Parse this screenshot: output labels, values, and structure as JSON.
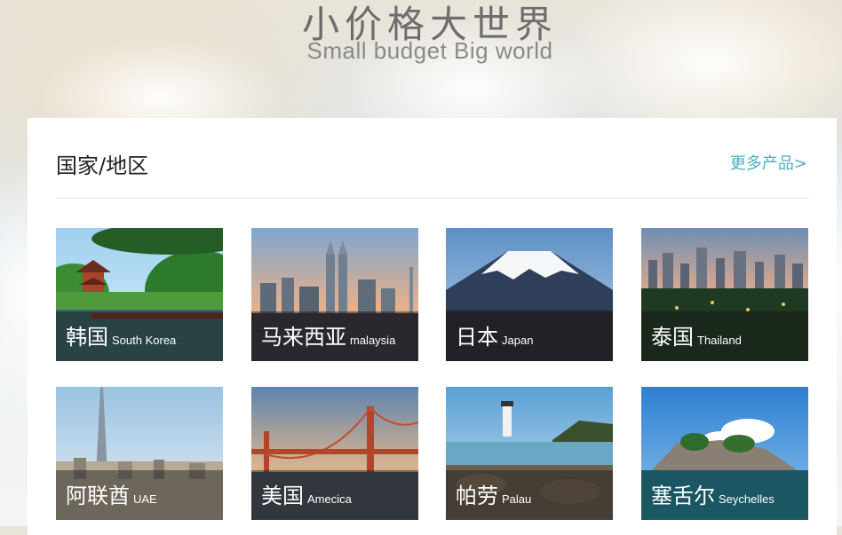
{
  "hero": {
    "title_cn": "小价格大世界",
    "title_en": "Small budget  Big world"
  },
  "section": {
    "title": "国家/地区",
    "more_link": "更多产品>"
  },
  "destinations": [
    {
      "name_cn": "韩国",
      "name_en": "South Korea",
      "scene": "pavilion"
    },
    {
      "name_cn": "马来西亚",
      "name_en": "malaysia",
      "scene": "twin-towers"
    },
    {
      "name_cn": "日本",
      "name_en": "Japan",
      "scene": "mount-fuji"
    },
    {
      "name_cn": "泰国",
      "name_en": "Thailand",
      "scene": "city-skyline"
    },
    {
      "name_cn": "阿联酋",
      "name_en": "UAE",
      "scene": "burj-tower"
    },
    {
      "name_cn": "美国",
      "name_en": "Amecica",
      "scene": "golden-gate"
    },
    {
      "name_cn": "帕劳",
      "name_en": "Palau",
      "scene": "lighthouse-coast"
    },
    {
      "name_cn": "塞舌尔",
      "name_en": "Seychelles",
      "scene": "tropical-island"
    }
  ],
  "colors": {
    "accent_link": "#4aaebf",
    "caption_overlay": "rgba(20,20,20,0.45)"
  }
}
